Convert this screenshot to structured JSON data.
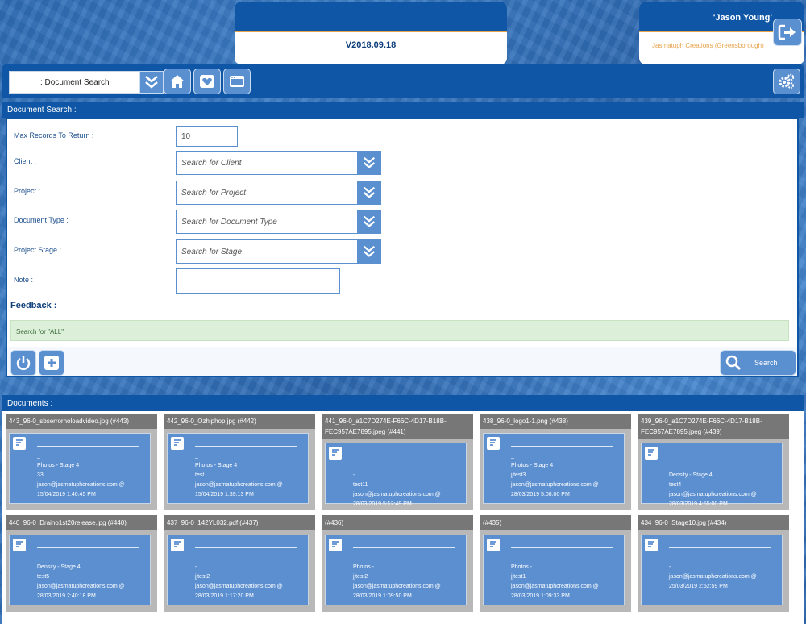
{
  "version": {
    "label": "V2018.09.18"
  },
  "user": {
    "name": "'Jason Young'",
    "company": "Jasmatuph Creations (Greensborough)"
  },
  "toolbar": {
    "module_select": ": Document Search"
  },
  "search_panel": {
    "title": "Document Search :",
    "fields": {
      "max_records": {
        "label": "Max Records To Return :",
        "value": "10"
      },
      "client": {
        "label": "Client :",
        "placeholder": "Search for Client"
      },
      "project": {
        "label": "Project :",
        "placeholder": "Search for Project"
      },
      "document_type": {
        "label": "Document Type :",
        "placeholder": "Search for Document Type"
      },
      "project_stage": {
        "label": "Project Stage :",
        "placeholder": "Search for Stage"
      },
      "note": {
        "label": "Note :",
        "value": ""
      }
    },
    "feedback_label": "Feedback :",
    "feedback_text": "Search for \"ALL\"",
    "search_button": "Search"
  },
  "documents_panel": {
    "title": "Documents :",
    "items": [
      {
        "title": "443_96-0_sbserrornoloadvideo.jpg (#443)",
        "l1": "_",
        "l2": "Photos - Stage 4",
        "l3": "33",
        "l4": "jason@jasmatuphcreations.com @",
        "l5": "15/04/2019 1:40:45 PM"
      },
      {
        "title": "442_96-0_Ozhiphop.jpg (#442)",
        "l1": "_",
        "l2": "Photos - Stage 4",
        "l3": "test",
        "l4": "jason@jasmatuphcreations.com @",
        "l5": "15/04/2019 1:39:13 PM"
      },
      {
        "title": "441_96-0_a1C7D274E-F66C-4D17-B18B-FEC957AE7895.jpeg (#441)",
        "l1": "_",
        "l2": "-",
        "l3": "test11",
        "l4": "jason@jasmatuphcreations.com @",
        "l5": "28/03/2019 5:12:49 PM"
      },
      {
        "title": "438_96-0_logo1-1.png (#438)",
        "l1": "_",
        "l2": "Photos - Stage 4",
        "l3": "jjtest3",
        "l4": "jason@jasmatuphcreations.com @",
        "l5": "28/03/2019 5:08:00 PM"
      },
      {
        "title": "439_96-0_a1C7D274E-F66C-4D17-B18B-FEC957AE7895.jpeg (#439)",
        "l1": "_",
        "l2": "Density - Stage 4",
        "l3": "test4",
        "l4": "jason@jasmatuphcreations.com @",
        "l5": "28/03/2019 4:55:00 PM"
      },
      {
        "title": "440_96-0_Draino1st20release.jpg (#440)",
        "l1": "_",
        "l2": "Density - Stage 4",
        "l3": "test5",
        "l4": "jason@jasmatuphcreations.com @",
        "l5": "28/03/2019 2:40:18 PM"
      },
      {
        "title": "437_96-0_142YL032.pdf (#437)",
        "l1": "_",
        "l2": "-",
        "l3": "jjtest2",
        "l4": "jason@jasmatuphcreations.com @",
        "l5": "28/03/2019 1:17:20 PM"
      },
      {
        "title": "(#436)",
        "l1": "_",
        "l2": "Photos -",
        "l3": "jjtest2",
        "l4": "jason@jasmatuphcreations.com @",
        "l5": "28/03/2019 1:09:50 PM"
      },
      {
        "title": "(#435)",
        "l1": "_",
        "l2": "Photos -",
        "l3": "jjtest1",
        "l4": "jason@jasmatuphcreations.com @",
        "l5": "28/03/2019 1:09:33 PM"
      },
      {
        "title": "434_96-0_Stage10.jpg (#434)",
        "l1": "_",
        "l2": "-",
        "l3": "",
        "l4": "jason@jasmatuphcreations.com @",
        "l5": "25/03/2019 2:52:59 PM"
      }
    ]
  }
}
